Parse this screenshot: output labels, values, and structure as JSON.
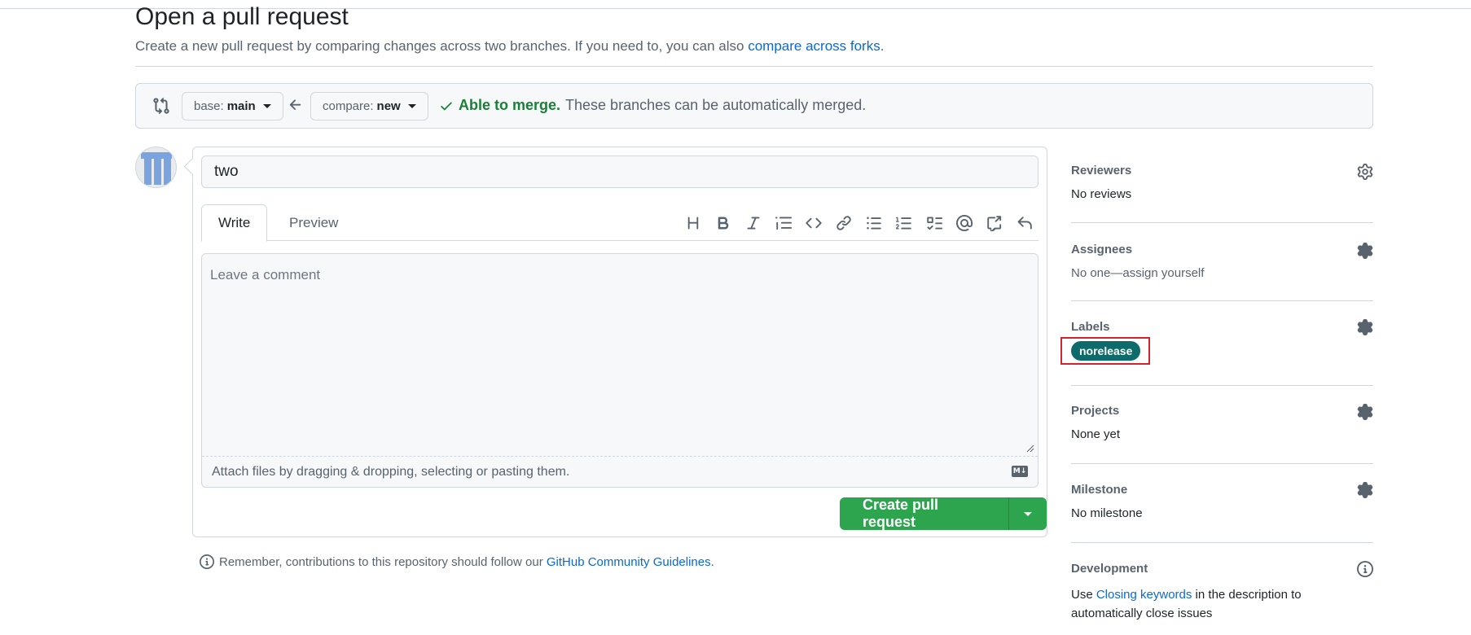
{
  "header": {
    "title": "Open a pull request",
    "subtitle_prefix": "Create a new pull request by comparing changes across two branches. If you need to, you can also ",
    "subtitle_link": "compare across forks",
    "subtitle_suffix": "."
  },
  "compare": {
    "base_prefix": "base:",
    "base_branch": "main",
    "compare_prefix": "compare:",
    "compare_branch": "new",
    "merge_ok": "Able to merge.",
    "merge_msg": "These branches can be automatically merged."
  },
  "form": {
    "title_value": "two",
    "tabs": [
      {
        "label": "Write"
      },
      {
        "label": "Preview"
      }
    ],
    "comment_placeholder": "Leave a comment",
    "attach_text": "Attach files by dragging & dropping, selecting or pasting them.",
    "md_badge": "M↓",
    "create_label": "Create pull request"
  },
  "guidelines": {
    "prefix": "Remember, contributions to this repository should follow our ",
    "link": "GitHub Community Guidelines",
    "suffix": "."
  },
  "sidebar": {
    "reviewers": {
      "heading": "Reviewers",
      "value": "No reviews"
    },
    "assignees": {
      "heading": "Assignees",
      "value_prefix": "No one—",
      "value_link": "assign yourself"
    },
    "labels": {
      "heading": "Labels",
      "items": [
        "norelease"
      ],
      "highlight_color": "#d1242f",
      "pill_color": "#0e6b6b"
    },
    "projects": {
      "heading": "Projects",
      "value": "None yet"
    },
    "milestone": {
      "heading": "Milestone",
      "value": "No milestone"
    },
    "development": {
      "heading": "Development",
      "value_prefix": "Use ",
      "value_link": "Closing keywords",
      "value_suffix": " in the description to automatically close issues"
    }
  },
  "colors": {
    "accent": "#0969da",
    "success": "#1a7f37",
    "button": "#2da44e"
  }
}
